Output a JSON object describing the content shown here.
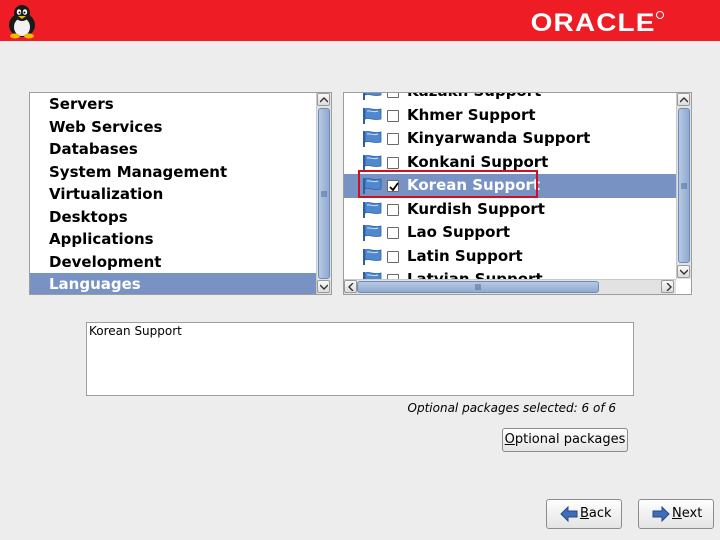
{
  "header": {
    "brand": "ORACLE",
    "brand_color": "#ee1c25"
  },
  "categories": {
    "items": [
      {
        "label": "Servers"
      },
      {
        "label": "Web Services"
      },
      {
        "label": "Databases"
      },
      {
        "label": "System Management"
      },
      {
        "label": "Virtualization"
      },
      {
        "label": "Desktops"
      },
      {
        "label": "Applications"
      },
      {
        "label": "Development"
      },
      {
        "label": "Languages",
        "selected": true
      }
    ]
  },
  "packages": {
    "items": [
      {
        "label": "Kazakh Support",
        "checked": false
      },
      {
        "label": "Khmer Support",
        "checked": false
      },
      {
        "label": "Kinyarwanda Support",
        "checked": false
      },
      {
        "label": "Konkani Support",
        "checked": false
      },
      {
        "label": "Korean Support",
        "checked": true,
        "selected": true
      },
      {
        "label": "Kurdish Support",
        "checked": false
      },
      {
        "label": "Lao Support",
        "checked": false
      },
      {
        "label": "Latin Support",
        "checked": false
      },
      {
        "label": "Latvian Support",
        "checked": false
      }
    ]
  },
  "details": {
    "description": "Korean Support",
    "optional_status": "Optional packages selected: 6 of 6"
  },
  "buttons": {
    "optional_packages_mnemonic": "O",
    "optional_packages_rest": "ptional packages",
    "back_mnemonic": "B",
    "back_rest": "ack",
    "next_mnemonic": "N",
    "next_rest": "ext"
  },
  "colors": {
    "selection": "#7792c3",
    "focus": "#d01020"
  },
  "icons": {
    "header": "tux-penguin-icon",
    "package": "package-flag-icon",
    "back": "arrow-left-icon",
    "next": "arrow-right-icon"
  }
}
